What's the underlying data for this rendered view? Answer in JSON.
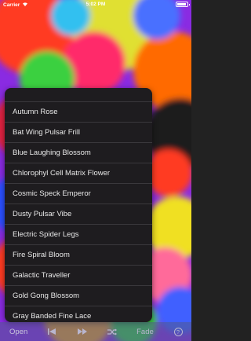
{
  "status_bar": {
    "carrier": "Carrier",
    "time": "5:02 PM"
  },
  "menu": {
    "items": [
      "Autumn Rose",
      "Bat Wing Pulsar Frill",
      "Blue Laughing Blossom",
      "Chlorophyl Cell Matrix Flower",
      "Cosmic Speck Emperor",
      "Dusty Pulsar Vibe",
      "Electric Spider Legs",
      "Fire Spiral Bloom",
      "Galactic Traveller",
      "Gold Gong Blossom",
      "Gray Banded Fine Lace"
    ]
  },
  "toolbar": {
    "open_label": "Open",
    "fade_label": "Fade",
    "help_label": "?",
    "prev_icon": "skip-back-icon",
    "next_icon": "skip-forward-icon",
    "shuffle_icon": "shuffle-icon"
  },
  "colors": {
    "menu_background": "#1e1c1f",
    "menu_text": "#e8e8e8",
    "toolbar_tint": "#505a8c"
  }
}
